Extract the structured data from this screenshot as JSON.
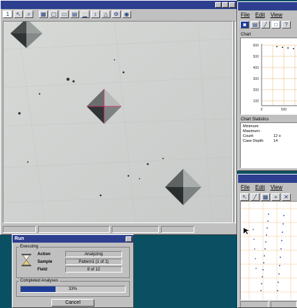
{
  "image_window": {
    "title": "",
    "toolbar": [
      "1",
      "",
      "",
      "",
      "",
      "",
      "",
      "",
      "",
      "",
      ""
    ],
    "status": [
      "",
      "",
      "",
      ""
    ]
  },
  "chart_window": {
    "title": "",
    "menu": [
      "File",
      "Edit",
      "View"
    ],
    "chart_label": "Chart",
    "y_axis_title": "",
    "y_ticks": [
      "600",
      "500",
      "400",
      "300",
      "200",
      "100"
    ],
    "x_ticks": [
      "0",
      "500",
      ""
    ],
    "stats_label": "Chart Statistics",
    "stats": [
      {
        "label": "Minimum:",
        "value": ""
      },
      {
        "label": "Maximum:",
        "value": ""
      },
      {
        "label": "Count:",
        "value": "12 o"
      },
      {
        "label": "Case Depth:",
        "value": "14"
      }
    ]
  },
  "pattern_window": {
    "title": "",
    "menu": [
      "File",
      "Edit",
      "View"
    ],
    "status": [
      "",
      ""
    ]
  },
  "run_dialog": {
    "title": "Run",
    "executing_label": "Executing",
    "rows": [
      {
        "label": "Action",
        "value": "Analyzing"
      },
      {
        "label": "Sample",
        "value": "Pattern1 (1 of 1)"
      },
      {
        "label": "Field",
        "value": "8 of 12"
      }
    ],
    "completed_label": "Completed Analyses",
    "progress": 33,
    "progress_text": "33%",
    "cancel_label": "Cancel"
  },
  "colors": {
    "desktop": "#0b4f63",
    "titlebar": "#2d3f8e",
    "progress": "#1d3c98",
    "chart_grid": "#e8b470",
    "trace_points": "#1a3fa0"
  }
}
